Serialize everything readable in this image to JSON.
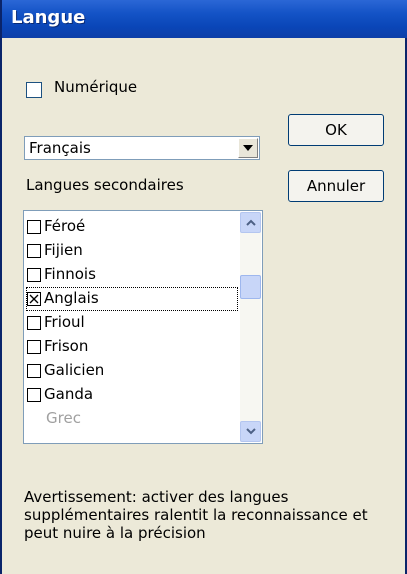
{
  "window": {
    "title": "Langue"
  },
  "numeric": {
    "label": "Numérique",
    "checked": false
  },
  "language_select": {
    "value": "Français",
    "icon": "dropdown-arrow-icon"
  },
  "buttons": {
    "ok": "OK",
    "cancel": "Annuler"
  },
  "secondary": {
    "label": "Langues secondaires",
    "items": [
      {
        "label": "Féroé",
        "checked": false,
        "enabled": true
      },
      {
        "label": "Fijien",
        "checked": false,
        "enabled": true
      },
      {
        "label": "Finnois",
        "checked": false,
        "enabled": true
      },
      {
        "label": "Anglais",
        "checked": true,
        "enabled": true
      },
      {
        "label": "Frioul",
        "checked": false,
        "enabled": true
      },
      {
        "label": "Frison",
        "checked": false,
        "enabled": true
      },
      {
        "label": "Galicien",
        "checked": false,
        "enabled": true
      },
      {
        "label": "Ganda",
        "checked": false,
        "enabled": true
      },
      {
        "label": "Grec",
        "checked": false,
        "enabled": false
      }
    ]
  },
  "warning": {
    "lines": [
      "Avertissement: activer des langues",
      "supplémentaires ralentit la reconnaissance et",
      "peut nuire à la précision"
    ]
  },
  "colors": {
    "titlebar": "#0A46B8",
    "face": "#ECE9D8",
    "scroll": "#C8D6F8"
  }
}
